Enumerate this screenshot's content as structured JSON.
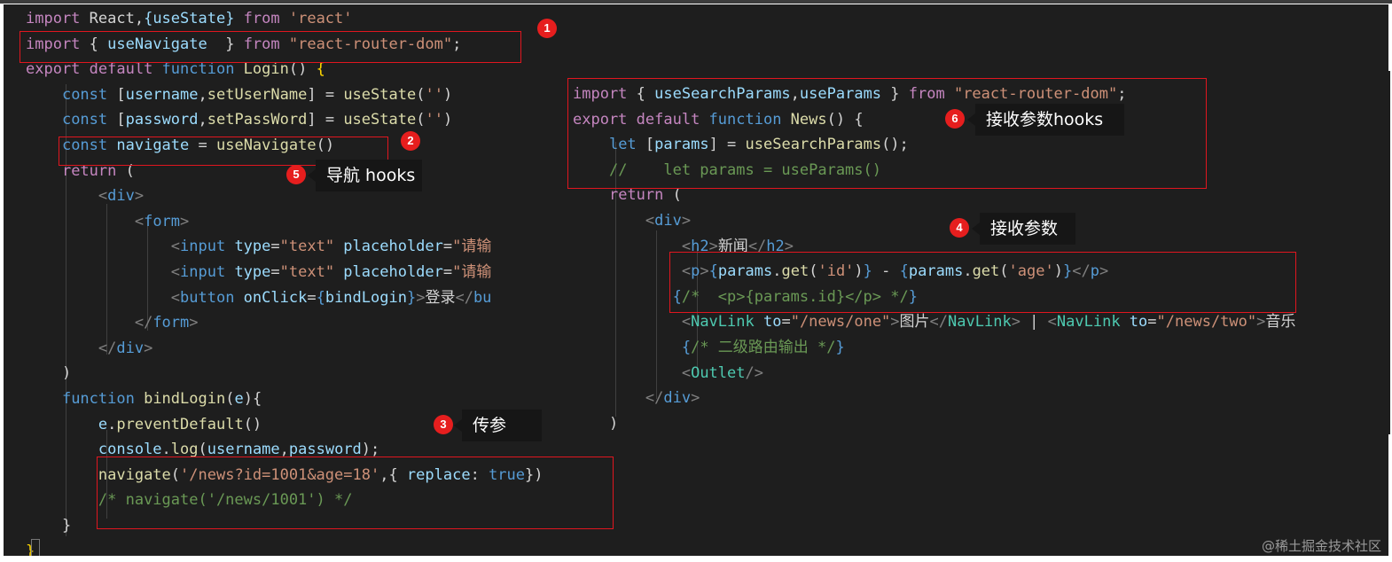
{
  "editor": {
    "left_code": [
      {
        "segments": [
          {
            "t": "import",
            "c": "c"
          },
          {
            "t": " React,",
            "c": "w"
          },
          {
            "t": "{useState}",
            "c": "v"
          },
          {
            "t": " from ",
            "c": "c"
          },
          {
            "t": "'react'",
            "c": "s"
          }
        ]
      },
      {
        "segments": [
          {
            "t": "import",
            "c": "c"
          },
          {
            "t": " { ",
            "c": "w"
          },
          {
            "t": "useNavigate",
            "c": "v"
          },
          {
            "t": "  } ",
            "c": "w"
          },
          {
            "t": "from",
            "c": "c"
          },
          {
            "t": " \"react-router-dom\"",
            "c": "s"
          },
          {
            "t": ";",
            "c": "w"
          }
        ]
      },
      {
        "segments": [
          {
            "t": "export",
            "c": "c"
          },
          {
            "t": " default ",
            "c": "c"
          },
          {
            "t": "function",
            "c": "k"
          },
          {
            "t": " Login",
            "c": "f"
          },
          {
            "t": "() ",
            "c": "w"
          },
          {
            "t": "{",
            "c": "b1"
          }
        ]
      },
      {
        "segments": [
          {
            "t": "    ",
            "c": "w"
          },
          {
            "t": "const",
            "c": "k"
          },
          {
            "t": " [",
            "c": "w"
          },
          {
            "t": "username",
            "c": "v"
          },
          {
            "t": ",",
            "c": "w"
          },
          {
            "t": "setUserName",
            "c": "f"
          },
          {
            "t": "] = ",
            "c": "w"
          },
          {
            "t": "useState",
            "c": "f"
          },
          {
            "t": "(",
            "c": "w"
          },
          {
            "t": "''",
            "c": "s"
          },
          {
            "t": ")",
            "c": "w"
          }
        ]
      },
      {
        "segments": [
          {
            "t": "    ",
            "c": "w"
          },
          {
            "t": "const",
            "c": "k"
          },
          {
            "t": " [",
            "c": "w"
          },
          {
            "t": "password",
            "c": "v"
          },
          {
            "t": ",",
            "c": "w"
          },
          {
            "t": "setPassWord",
            "c": "f"
          },
          {
            "t": "] = ",
            "c": "w"
          },
          {
            "t": "useState",
            "c": "f"
          },
          {
            "t": "(",
            "c": "w"
          },
          {
            "t": "''",
            "c": "s"
          },
          {
            "t": ")",
            "c": "w"
          }
        ]
      },
      {
        "segments": [
          {
            "t": "    ",
            "c": "w"
          },
          {
            "t": "const",
            "c": "k"
          },
          {
            "t": " navigate",
            "c": "v"
          },
          {
            "t": " = ",
            "c": "w"
          },
          {
            "t": "useNavigate",
            "c": "f"
          },
          {
            "t": "()",
            "c": "w"
          }
        ]
      },
      {
        "segments": [
          {
            "t": "    ",
            "c": "w"
          },
          {
            "t": "return",
            "c": "c"
          },
          {
            "t": " (",
            "c": "w"
          }
        ]
      },
      {
        "segments": [
          {
            "t": "        ",
            "c": "w"
          },
          {
            "t": "<",
            "c": "p"
          },
          {
            "t": "div",
            "c": "k"
          },
          {
            "t": ">",
            "c": "p"
          }
        ]
      },
      {
        "segments": [
          {
            "t": "            ",
            "c": "w"
          },
          {
            "t": "<",
            "c": "p"
          },
          {
            "t": "form",
            "c": "k"
          },
          {
            "t": ">",
            "c": "p"
          }
        ]
      },
      {
        "segments": [
          {
            "t": "                ",
            "c": "w"
          },
          {
            "t": "<",
            "c": "p"
          },
          {
            "t": "input",
            "c": "k"
          },
          {
            "t": " type",
            "c": "v"
          },
          {
            "t": "=",
            "c": "w"
          },
          {
            "t": "\"text\"",
            "c": "s"
          },
          {
            "t": " placeholder",
            "c": "v"
          },
          {
            "t": "=",
            "c": "w"
          },
          {
            "t": "\"请输",
            "c": "s"
          }
        ]
      },
      {
        "segments": [
          {
            "t": "                ",
            "c": "w"
          },
          {
            "t": "<",
            "c": "p"
          },
          {
            "t": "input",
            "c": "k"
          },
          {
            "t": " type",
            "c": "v"
          },
          {
            "t": "=",
            "c": "w"
          },
          {
            "t": "\"text\"",
            "c": "s"
          },
          {
            "t": " placeholder",
            "c": "v"
          },
          {
            "t": "=",
            "c": "w"
          },
          {
            "t": "\"请输",
            "c": "s"
          }
        ]
      },
      {
        "segments": [
          {
            "t": "                ",
            "c": "w"
          },
          {
            "t": "<",
            "c": "p"
          },
          {
            "t": "button",
            "c": "k"
          },
          {
            "t": " onClick",
            "c": "v"
          },
          {
            "t": "=",
            "c": "w"
          },
          {
            "t": "{",
            "c": "k"
          },
          {
            "t": "bindLogin",
            "c": "v"
          },
          {
            "t": "}",
            "c": "k"
          },
          {
            "t": ">",
            "c": "p"
          },
          {
            "t": "登录",
            "c": "w"
          },
          {
            "t": "</",
            "c": "p"
          },
          {
            "t": "bu",
            "c": "k"
          }
        ]
      },
      {
        "segments": [
          {
            "t": "            ",
            "c": "w"
          },
          {
            "t": "</",
            "c": "p"
          },
          {
            "t": "form",
            "c": "k"
          },
          {
            "t": ">",
            "c": "p"
          }
        ]
      },
      {
        "segments": [
          {
            "t": "        ",
            "c": "w"
          },
          {
            "t": "</",
            "c": "p"
          },
          {
            "t": "div",
            "c": "k"
          },
          {
            "t": ">",
            "c": "p"
          }
        ]
      },
      {
        "segments": [
          {
            "t": "    )",
            "c": "w"
          }
        ]
      },
      {
        "segments": [
          {
            "t": "    ",
            "c": "w"
          },
          {
            "t": "function",
            "c": "k"
          },
          {
            "t": " bindLogin",
            "c": "f"
          },
          {
            "t": "(",
            "c": "w"
          },
          {
            "t": "e",
            "c": "v"
          },
          {
            "t": "){",
            "c": "w"
          }
        ]
      },
      {
        "segments": [
          {
            "t": "        ",
            "c": "w"
          },
          {
            "t": "e",
            "c": "v"
          },
          {
            "t": ".",
            "c": "w"
          },
          {
            "t": "preventDefault",
            "c": "f"
          },
          {
            "t": "()",
            "c": "w"
          }
        ]
      },
      {
        "segments": [
          {
            "t": "        ",
            "c": "w"
          },
          {
            "t": "console",
            "c": "v"
          },
          {
            "t": ".",
            "c": "w"
          },
          {
            "t": "log",
            "c": "f"
          },
          {
            "t": "(",
            "c": "w"
          },
          {
            "t": "username",
            "c": "v"
          },
          {
            "t": ",",
            "c": "w"
          },
          {
            "t": "password",
            "c": "v"
          },
          {
            "t": ");",
            "c": "w"
          }
        ]
      },
      {
        "segments": [
          {
            "t": "        ",
            "c": "w"
          },
          {
            "t": "navigate",
            "c": "f"
          },
          {
            "t": "(",
            "c": "w"
          },
          {
            "t": "'/news?id=1001&age=18'",
            "c": "s"
          },
          {
            "t": ",{ ",
            "c": "w"
          },
          {
            "t": "replace",
            "c": "v"
          },
          {
            "t": ": ",
            "c": "w"
          },
          {
            "t": "true",
            "c": "k"
          },
          {
            "t": "})",
            "c": "w"
          }
        ]
      },
      {
        "segments": [
          {
            "t": "        ",
            "c": "w"
          },
          {
            "t": "/* navigate('/news/1001') */",
            "c": "m"
          }
        ]
      },
      {
        "segments": [
          {
            "t": "    }",
            "c": "w"
          }
        ]
      },
      {
        "segments": [
          {
            "t": "}",
            "c": "b1"
          }
        ]
      }
    ],
    "right_code": [
      {
        "segments": [
          {
            "t": "import",
            "c": "c"
          },
          {
            "t": " { ",
            "c": "w"
          },
          {
            "t": "useSearchParams",
            "c": "v"
          },
          {
            "t": ",",
            "c": "w"
          },
          {
            "t": "useParams",
            "c": "v"
          },
          {
            "t": " } ",
            "c": "w"
          },
          {
            "t": "from",
            "c": "c"
          },
          {
            "t": " \"react-router-dom\"",
            "c": "s"
          },
          {
            "t": ";",
            "c": "w"
          }
        ]
      },
      {
        "segments": [
          {
            "t": "export",
            "c": "c"
          },
          {
            "t": " default ",
            "c": "c"
          },
          {
            "t": "function",
            "c": "k"
          },
          {
            "t": " News",
            "c": "f"
          },
          {
            "t": "() {",
            "c": "w"
          }
        ]
      },
      {
        "segments": [
          {
            "t": "    ",
            "c": "w"
          },
          {
            "t": "let",
            "c": "k"
          },
          {
            "t": " [",
            "c": "w"
          },
          {
            "t": "params",
            "c": "v"
          },
          {
            "t": "] = ",
            "c": "w"
          },
          {
            "t": "useSearchParams",
            "c": "f"
          },
          {
            "t": "();",
            "c": "w"
          }
        ]
      },
      {
        "segments": [
          {
            "t": "    ",
            "c": "w"
          },
          {
            "t": "//    let params = useParams()",
            "c": "m"
          }
        ]
      },
      {
        "segments": [
          {
            "t": "    ",
            "c": "w"
          },
          {
            "t": "return",
            "c": "c"
          },
          {
            "t": " (",
            "c": "w"
          }
        ]
      },
      {
        "segments": [
          {
            "t": "        ",
            "c": "w"
          },
          {
            "t": "<",
            "c": "p"
          },
          {
            "t": "div",
            "c": "k"
          },
          {
            "t": ">",
            "c": "p"
          }
        ]
      },
      {
        "segments": [
          {
            "t": "            ",
            "c": "w"
          },
          {
            "t": "<",
            "c": "p"
          },
          {
            "t": "h2",
            "c": "k"
          },
          {
            "t": ">",
            "c": "p"
          },
          {
            "t": "新闻",
            "c": "w"
          },
          {
            "t": "</",
            "c": "p"
          },
          {
            "t": "h2",
            "c": "k"
          },
          {
            "t": ">",
            "c": "p"
          }
        ]
      },
      {
        "segments": [
          {
            "t": "            ",
            "c": "w"
          },
          {
            "t": "<",
            "c": "p"
          },
          {
            "t": "p",
            "c": "k"
          },
          {
            "t": ">",
            "c": "p"
          },
          {
            "t": "{",
            "c": "k"
          },
          {
            "t": "params",
            "c": "v"
          },
          {
            "t": ".",
            "c": "w"
          },
          {
            "t": "get",
            "c": "f"
          },
          {
            "t": "(",
            "c": "w"
          },
          {
            "t": "'id'",
            "c": "s"
          },
          {
            "t": ")",
            "c": "w"
          },
          {
            "t": "}",
            "c": "k"
          },
          {
            "t": " - ",
            "c": "w"
          },
          {
            "t": "{",
            "c": "k"
          },
          {
            "t": "params",
            "c": "v"
          },
          {
            "t": ".",
            "c": "w"
          },
          {
            "t": "get",
            "c": "f"
          },
          {
            "t": "(",
            "c": "w"
          },
          {
            "t": "'age'",
            "c": "s"
          },
          {
            "t": ")",
            "c": "w"
          },
          {
            "t": "}",
            "c": "k"
          },
          {
            "t": "</",
            "c": "p"
          },
          {
            "t": "p",
            "c": "k"
          },
          {
            "t": ">",
            "c": "p"
          }
        ]
      },
      {
        "segments": [
          {
            "t": "           ",
            "c": "w"
          },
          {
            "t": "{",
            "c": "k"
          },
          {
            "t": "/*  <p>{params.id}</p> */",
            "c": "m"
          },
          {
            "t": "}",
            "c": "k"
          }
        ]
      },
      {
        "segments": [
          {
            "t": "            ",
            "c": "w"
          },
          {
            "t": "<",
            "c": "p"
          },
          {
            "t": "NavLink",
            "c": "t"
          },
          {
            "t": " to",
            "c": "v"
          },
          {
            "t": "=",
            "c": "w"
          },
          {
            "t": "\"/news/one\"",
            "c": "s"
          },
          {
            "t": ">",
            "c": "p"
          },
          {
            "t": "图片",
            "c": "w"
          },
          {
            "t": "</",
            "c": "p"
          },
          {
            "t": "NavLink",
            "c": "t"
          },
          {
            "t": ">",
            "c": "p"
          },
          {
            "t": " | ",
            "c": "w"
          },
          {
            "t": "<",
            "c": "p"
          },
          {
            "t": "NavLink",
            "c": "t"
          },
          {
            "t": " to",
            "c": "v"
          },
          {
            "t": "=",
            "c": "w"
          },
          {
            "t": "\"/news/two\"",
            "c": "s"
          },
          {
            "t": ">",
            "c": "p"
          },
          {
            "t": "音乐",
            "c": "w"
          }
        ]
      },
      {
        "segments": [
          {
            "t": "            ",
            "c": "w"
          },
          {
            "t": "{",
            "c": "k"
          },
          {
            "t": "/* 二级路由输出 */",
            "c": "m"
          },
          {
            "t": "}",
            "c": "k"
          }
        ]
      },
      {
        "segments": [
          {
            "t": "            ",
            "c": "w"
          },
          {
            "t": "<",
            "c": "p"
          },
          {
            "t": "Outlet",
            "c": "t"
          },
          {
            "t": "/>",
            "c": "p"
          }
        ]
      },
      {
        "segments": [
          {
            "t": "        ",
            "c": "w"
          },
          {
            "t": "</",
            "c": "p"
          },
          {
            "t": "div",
            "c": "k"
          },
          {
            "t": ">",
            "c": "p"
          }
        ]
      },
      {
        "segments": [
          {
            "t": "    )",
            "c": "w"
          }
        ]
      }
    ]
  },
  "annotations": [
    {
      "num": "1"
    },
    {
      "num": "2"
    },
    {
      "num": "3",
      "label": "传参"
    },
    {
      "num": "4",
      "label": "接收参数"
    },
    {
      "num": "5",
      "label": "导航 hooks"
    },
    {
      "num": "6",
      "label": "接收参数hooks"
    }
  ],
  "watermark": "@稀土掘金技术社区",
  "colors": {
    "background": "#1e1e1e",
    "keyword": "#569cd6",
    "control": "#c586c0",
    "function": "#dcdcaa",
    "variable": "#9cdcfe",
    "string": "#ce9178",
    "comment": "#6a9955",
    "component": "#4ec9b0",
    "highlight_box": "#e0161f"
  }
}
